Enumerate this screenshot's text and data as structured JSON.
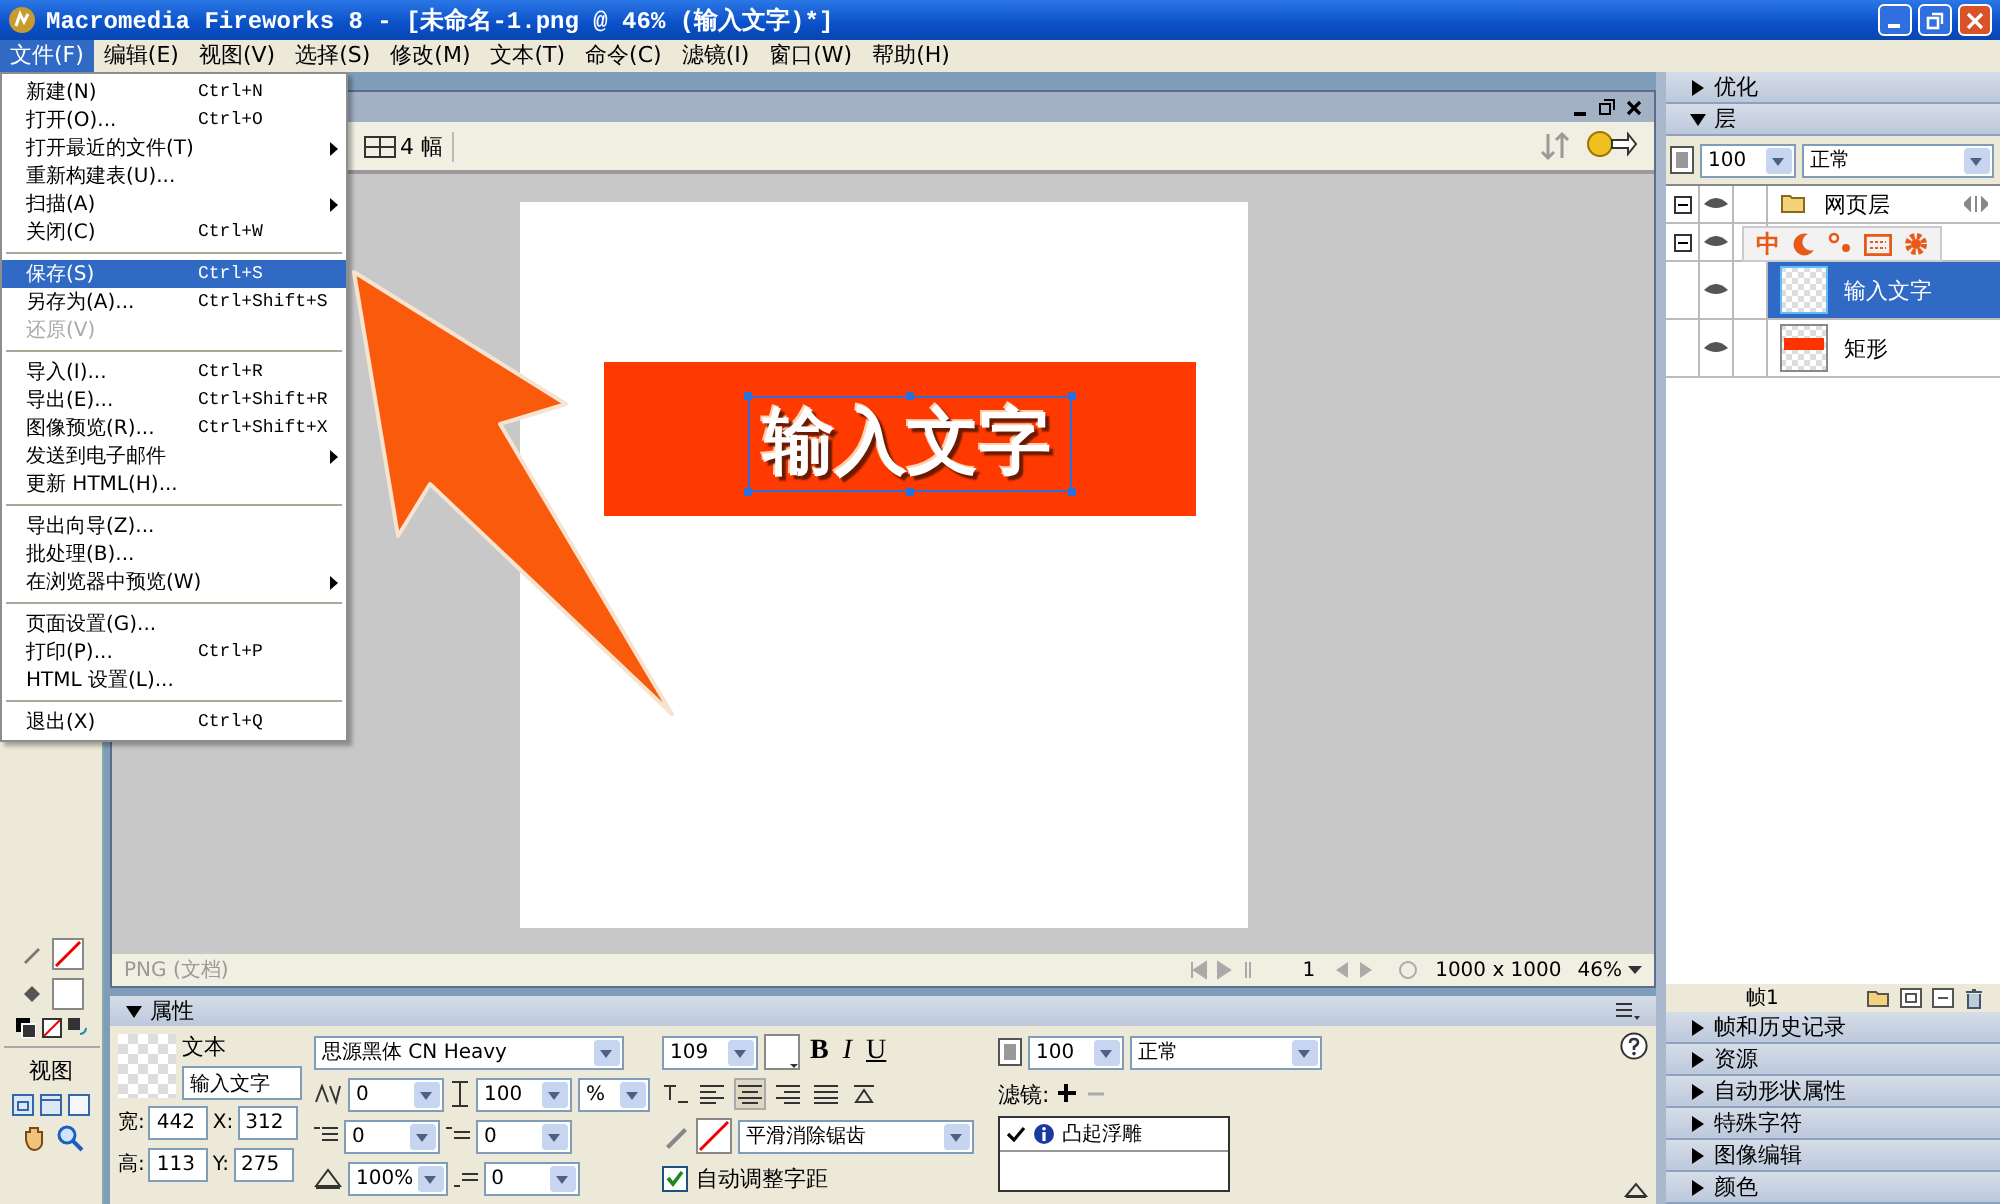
{
  "title_bar": {
    "title": "Macromedia Fireworks 8 - [未命名-1.png @  46% (输入文字)*]"
  },
  "menu_bar": [
    {
      "label": "文件(F)",
      "selected": true
    },
    {
      "label": "编辑(E)",
      "selected": false
    },
    {
      "label": "视图(V)",
      "selected": false
    },
    {
      "label": "选择(S)",
      "selected": false
    },
    {
      "label": "修改(M)",
      "selected": false
    },
    {
      "label": "文本(T)",
      "selected": false
    },
    {
      "label": "命令(C)",
      "selected": false
    },
    {
      "label": "滤镜(I)",
      "selected": false
    },
    {
      "label": "窗口(W)",
      "selected": false
    },
    {
      "label": "帮助(H)",
      "selected": false
    }
  ],
  "file_menu": {
    "groups": [
      [
        {
          "label": "新建(N)",
          "shortcut": "Ctrl+N",
          "submenu": false,
          "disabled": false,
          "selected": false
        },
        {
          "label": "打开(O)...",
          "shortcut": "Ctrl+O",
          "submenu": false,
          "disabled": false,
          "selected": false
        },
        {
          "label": "打开最近的文件(T)",
          "submenu": true,
          "disabled": false,
          "selected": false
        },
        {
          "label": "重新构建表(U)...",
          "submenu": false,
          "disabled": false,
          "selected": false
        },
        {
          "label": "扫描(A)",
          "submenu": true,
          "disabled": false,
          "selected": false
        },
        {
          "label": "关闭(C)",
          "shortcut": "Ctrl+W",
          "submenu": false,
          "disabled": false,
          "selected": false
        }
      ],
      [
        {
          "label": "保存(S)",
          "shortcut": "Ctrl+S",
          "submenu": false,
          "disabled": false,
          "selected": true
        },
        {
          "label": "另存为(A)...",
          "shortcut": "Ctrl+Shift+S",
          "submenu": false,
          "disabled": false,
          "selected": false
        },
        {
          "label": "还原(V)",
          "submenu": false,
          "disabled": true,
          "selected": false
        }
      ],
      [
        {
          "label": "导入(I)...",
          "shortcut": "Ctrl+R",
          "submenu": false,
          "disabled": false,
          "selected": false
        },
        {
          "label": "导出(E)...",
          "shortcut": "Ctrl+Shift+R",
          "submenu": false,
          "disabled": false,
          "selected": false
        },
        {
          "label": "图像预览(R)...",
          "shortcut": "Ctrl+Shift+X",
          "submenu": false,
          "disabled": false,
          "selected": false
        },
        {
          "label": "发送到电子邮件",
          "submenu": true,
          "disabled": false,
          "selected": false
        },
        {
          "label": "更新 HTML(H)...",
          "submenu": false,
          "disabled": false,
          "selected": false
        }
      ],
      [
        {
          "label": "导出向导(Z)...",
          "submenu": false,
          "disabled": false,
          "selected": false
        },
        {
          "label": "批处理(B)...",
          "submenu": false,
          "disabled": false,
          "selected": false
        },
        {
          "label": "在浏览器中预览(W)",
          "submenu": true,
          "disabled": false,
          "selected": false
        }
      ],
      [
        {
          "label": "页面设置(G)...",
          "submenu": false,
          "disabled": false,
          "selected": false
        },
        {
          "label": "打印(P)...",
          "shortcut": "Ctrl+P",
          "submenu": false,
          "disabled": false,
          "selected": false
        },
        {
          "label": "HTML 设置(L)...",
          "submenu": false,
          "disabled": false,
          "selected": false
        }
      ],
      [
        {
          "label": "退出(X)",
          "shortcut": "Ctrl+Q",
          "submenu": false,
          "disabled": false,
          "selected": false
        }
      ]
    ]
  },
  "tools": {
    "section_label": "视图"
  },
  "document": {
    "view_label": "4 幅",
    "canvas_text": "输入文字",
    "status": {
      "format": "PNG (文档)",
      "frame": "1",
      "size": "1000 x 1000",
      "zoom": "46%"
    }
  },
  "properties": {
    "title": "属性",
    "object_type": "文本",
    "object_name": "输入文字",
    "dims": [
      {
        "label": "宽:",
        "value": "442"
      },
      {
        "label": "X:",
        "value": "312"
      },
      {
        "label": "高:",
        "value": "113"
      },
      {
        "label": "Y:",
        "value": "275"
      }
    ],
    "font": "思源黑体 CN Heavy",
    "size": "109",
    "kerning": "0",
    "leading": "100",
    "leading_unit": "%",
    "indents": [
      "0",
      "0",
      "100%",
      "0"
    ],
    "style_buttons": [
      {
        "label": "B",
        "selected": false
      },
      {
        "label": "I",
        "selected": false
      },
      {
        "label": "U",
        "selected": false
      }
    ],
    "align": [
      {
        "selected": false
      },
      {
        "selected": true
      },
      {
        "selected": false
      },
      {
        "selected": false
      },
      {
        "selected": false
      }
    ],
    "antialias": "平滑消除锯齿",
    "auto_kern": {
      "label": "自动调整字距",
      "checked": true
    },
    "opacity": "100",
    "blend": "正常",
    "filters_label": "滤镜:",
    "filters": [
      {
        "name": "凸起浮雕",
        "enabled": true
      }
    ]
  },
  "right_panel": {
    "top_panels": [
      {
        "title": "优化",
        "expanded": false
      },
      {
        "title": "层",
        "expanded": true
      }
    ],
    "opacity": "100",
    "blend": "正常",
    "layers": [
      {
        "name": "网页层",
        "kind": "web",
        "expanded": true
      },
      {
        "kind": "layer",
        "expanded": true,
        "children": [
          {
            "name": "输入文字",
            "kind": "text",
            "selected": true
          },
          {
            "name": "矩形",
            "kind": "rect",
            "selected": false
          }
        ]
      }
    ],
    "ime_mode": "中",
    "frame": "帧1",
    "bottom_panels": [
      {
        "title": "帧和历史记录",
        "expanded": false
      },
      {
        "title": "资源",
        "expanded": false
      },
      {
        "title": "自动形状属性",
        "expanded": false
      },
      {
        "title": "特殊字符",
        "expanded": false
      },
      {
        "title": "图像编辑",
        "expanded": false
      },
      {
        "title": "颜色",
        "expanded": false
      }
    ]
  }
}
